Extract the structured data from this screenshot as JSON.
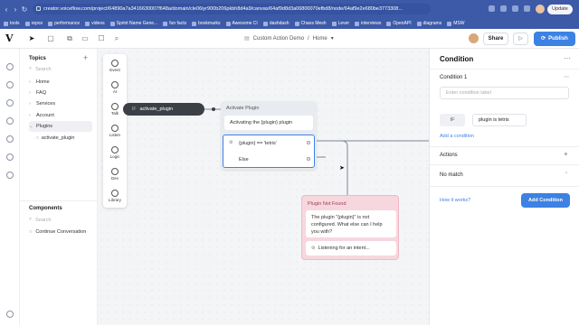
{
  "browser": {
    "url": "creator.voiceflow.com/project/64890a7a3416630007f648a/domain/cle06iyr900b206pkbh8d4a9/canvas/64af9d8d3a06800070efbd8/node/64af9e2e680be3773308...",
    "update_label": "Update",
    "bookmarks": [
      "tools",
      "repos",
      "performance",
      "videos",
      "Sprint Name Gene...",
      "fun facts",
      "bookmarks",
      "Awesome CI",
      "dashdash",
      "Chaos Mesh",
      "Lever",
      "interviews",
      "OpenAPI",
      "diagrams",
      "MSW"
    ]
  },
  "header": {
    "logo": "V",
    "doc_title": "Custom Action Demo",
    "separator": "/",
    "doc_page": "Home",
    "share_label": "Share",
    "publish_label": "Publish"
  },
  "topics": {
    "title": "Topics",
    "search_placeholder": "Search",
    "items": [
      {
        "label": "Home"
      },
      {
        "label": "FAQ"
      },
      {
        "label": "Services"
      },
      {
        "label": "Account"
      },
      {
        "label": "Plugins"
      }
    ],
    "sub_item": {
      "tag": "□",
      "label": "activate_plugin"
    },
    "components_title": "Components",
    "components_search": "Search",
    "components_item": "Continue Conversation"
  },
  "toolbox": {
    "items": [
      "Event",
      "AI",
      "Talk",
      "Listen",
      "Logic",
      "Dev",
      "Library"
    ]
  },
  "canvas": {
    "trigger_tag": "IF",
    "trigger_label": "activate_plugin",
    "activate_block_title": "Activate Plugin",
    "activating_step": "Activating the {plugin} plugin",
    "condition_step": "{plugin} == 'tetris'",
    "else_step": "Else",
    "notfound_title": "Plugin Not Found",
    "notfound_text": "The plugin \"{plugin}\" is not configured. What else can I help you with?",
    "listening_text": "Listening for an intent..."
  },
  "editor": {
    "title": "Condition",
    "condition_header": "Condition 1",
    "label_placeholder": "Enter condition label",
    "if_label": "IF",
    "condition_value": "plugin is tetris",
    "add_condition_link": "Add a condition",
    "actions_label": "Actions",
    "no_match_label": "No match",
    "how_link": "How it works?",
    "add_condition_button": "Add Condition"
  },
  "colors": {
    "accent": "#3d82e3",
    "browser_bar": "#3d5aa8",
    "notfound_bg": "#f7d7de"
  }
}
